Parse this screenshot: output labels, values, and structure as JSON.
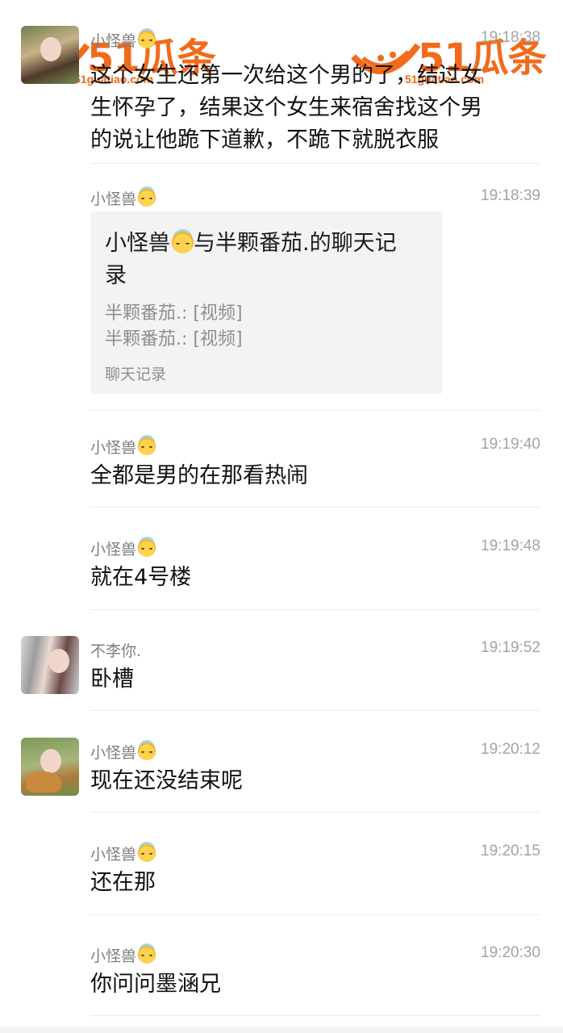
{
  "watermark": {
    "logo": "51瓜条",
    "site": "51guatiao.com"
  },
  "messages": [
    {
      "name": "小怪兽",
      "time": "19:18:38",
      "text_lines": [
        "这个女生还第一次给这个男的了，结过女",
        "生怀孕了，结果这个女生来宿舍找这个男",
        "的说让他跪下道歉，不跪下就脱衣服"
      ]
    },
    {
      "name": "小怪兽",
      "time": "19:18:39"
    },
    {
      "name": "小怪兽",
      "time": "19:19:40",
      "text": "全都是男的在那看热闹"
    },
    {
      "name": "小怪兽",
      "time": "19:19:48",
      "text": "就在4号楼"
    },
    {
      "name": "不李你.",
      "time": "19:19:52",
      "text": "卧槽"
    },
    {
      "name": "小怪兽",
      "time": "19:20:12",
      "text": "现在还没结束呢"
    },
    {
      "name": "小怪兽",
      "time": "19:20:15",
      "text": "还在那"
    },
    {
      "name": "小怪兽",
      "time": "19:20:30",
      "text": "你问问墨涵兄"
    }
  ],
  "record_card": {
    "title_part1": "小怪兽",
    "title_part2": "与半颗番茄.的聊天记",
    "title_part3": "录",
    "line1": "半颗番茄.: [视频]",
    "line2": "半颗番茄.: [视频]",
    "footer": "聊天记录"
  }
}
